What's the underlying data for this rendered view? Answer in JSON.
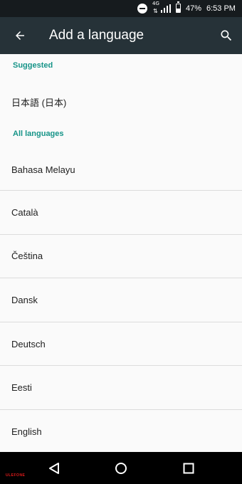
{
  "status_bar": {
    "network": "4G",
    "battery_percent": "47%",
    "battery_level": 0.47,
    "time": "6:53 PM"
  },
  "app_bar": {
    "title": "Add a language",
    "back_icon": "arrow-back-icon",
    "search_icon": "search-icon"
  },
  "sections": {
    "suggested": "Suggested",
    "all_languages": "All languages"
  },
  "suggested_languages": [
    "日本語 (日本)"
  ],
  "languages": [
    "Bahasa Melayu",
    "Català",
    "Čeština",
    "Dansk",
    "Deutsch",
    "Eesti",
    "English"
  ],
  "nav_bar": {
    "back_icon": "triangle-back-icon",
    "home_icon": "circle-home-icon",
    "recents_icon": "square-recents-icon",
    "brand_logo": "ULEFONE"
  },
  "colors": {
    "status_bar": "#161b1e",
    "app_bar": "#263238",
    "accent": "#169488",
    "background": "#fafafa"
  }
}
